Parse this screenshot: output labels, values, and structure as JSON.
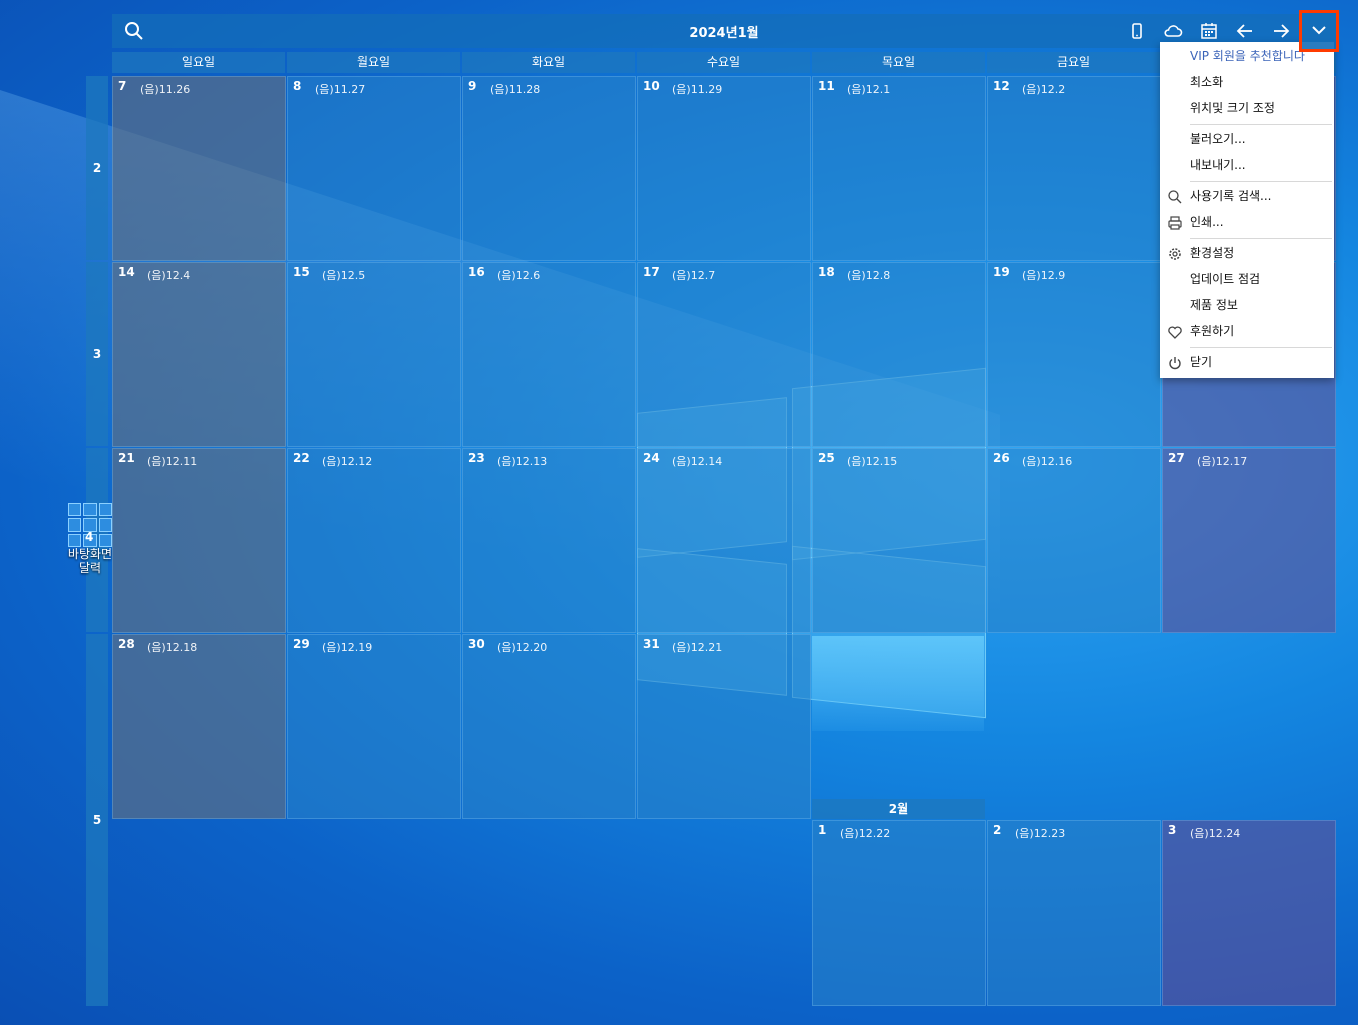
{
  "toolbar": {
    "title": "2024년1월",
    "icons": [
      "search-icon",
      "mobile-icon",
      "cloud-icon",
      "calendar-icon",
      "arrow-left-icon",
      "arrow-right-icon",
      "chevron-down-icon"
    ]
  },
  "days": [
    "일요일",
    "월요일",
    "화요일",
    "수요일",
    "목요일",
    "금요일"
  ],
  "weeks": [
    "2",
    "3",
    "4",
    "5"
  ],
  "cells": [
    {
      "d": "7",
      "l": "(음)11.26"
    },
    {
      "d": "8",
      "l": "(음)11.27"
    },
    {
      "d": "9",
      "l": "(음)11.28"
    },
    {
      "d": "10",
      "l": "(음)11.29"
    },
    {
      "d": "11",
      "l": "(음)12.1"
    },
    {
      "d": "12",
      "l": "(음)12.2"
    },
    {
      "d": "14",
      "l": "(음)12.4"
    },
    {
      "d": "15",
      "l": "(음)12.5"
    },
    {
      "d": "16",
      "l": "(음)12.6"
    },
    {
      "d": "17",
      "l": "(음)12.7"
    },
    {
      "d": "18",
      "l": "(음)12.8"
    },
    {
      "d": "19",
      "l": "(음)12.9"
    },
    {
      "d": "21",
      "l": "(음)12.11"
    },
    {
      "d": "22",
      "l": "(음)12.12"
    },
    {
      "d": "23",
      "l": "(음)12.13"
    },
    {
      "d": "24",
      "l": "(음)12.14"
    },
    {
      "d": "25",
      "l": "(음)12.15"
    },
    {
      "d": "26",
      "l": "(음)12.16"
    },
    {
      "d": "27",
      "l": "(음)12.17"
    },
    {
      "d": "28",
      "l": "(음)12.18"
    },
    {
      "d": "29",
      "l": "(음)12.19"
    },
    {
      "d": "30",
      "l": "(음)12.20"
    },
    {
      "d": "31",
      "l": "(음)12.21"
    }
  ],
  "february": {
    "header": "2월",
    "cells": [
      {
        "d": "1",
        "l": "(음)12.22"
      },
      {
        "d": "2",
        "l": "(음)12.23"
      },
      {
        "d": "3",
        "l": "(음)12.24"
      }
    ]
  },
  "desktop_icon": {
    "label_line1": "바탕화면",
    "label_line2": "달력"
  },
  "menu": {
    "vip": "VIP 회원을 추천합니다",
    "minimize": "최소화",
    "position_size": "위치및 크기 조정",
    "import": "불러오기...",
    "export": "내보내기...",
    "history_search": "사용기록 검색...",
    "print": "인쇄...",
    "settings": "환경설정",
    "check_update": "업데이트 점검",
    "product_info": "제품 정보",
    "donate": "후원하기",
    "close": "닫기"
  }
}
